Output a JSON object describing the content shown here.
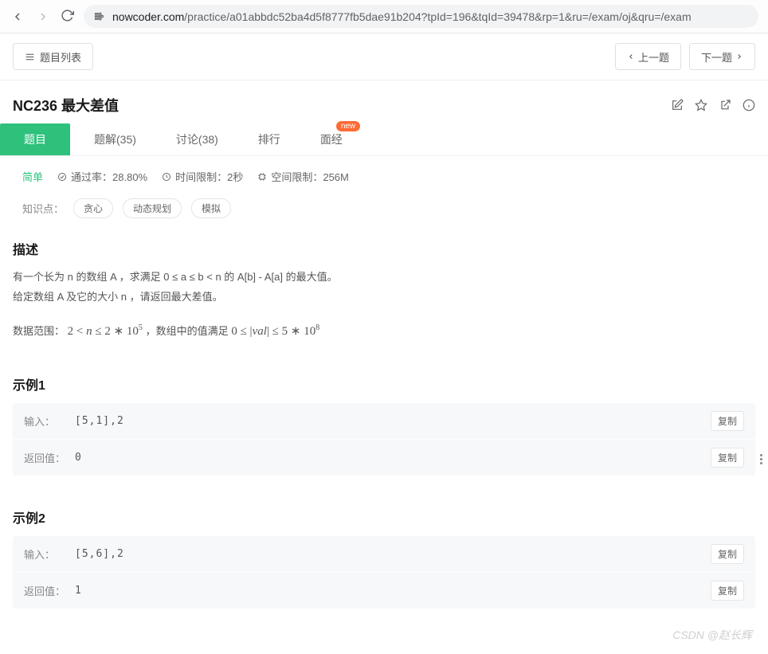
{
  "browser": {
    "url_domain": "nowcoder.com",
    "url_path": "/practice/a01abbdc52ba4d5f8777fb5dae91b204?tpId=196&tqId=39478&rp=1&ru=/exam/oj&qru=/exam"
  },
  "top": {
    "list_btn": "题目列表",
    "prev_btn": "上一题",
    "next_btn": "下一题"
  },
  "title": "NC236  最大差值",
  "tabs": {
    "problem": "题目",
    "solution": "题解(35)",
    "discuss": "讨论(38)",
    "rank": "排行",
    "interview": "面经",
    "new_badge": "new"
  },
  "meta": {
    "difficulty": "简单",
    "passrate": "通过率：28.80%",
    "timelimit": "时间限制：2秒",
    "memlimit": "空间限制：256M"
  },
  "tags": {
    "label": "知识点：",
    "items": [
      "贪心",
      "动态规划",
      "模拟"
    ]
  },
  "desc": {
    "heading": "描述",
    "line1": "有一个长为 n 的数组 A ，求满足 0 ≤ a ≤ b < n 的 A[b] - A[a] 的最大值。",
    "line2": "给定数组 A 及它的大小 n ，请返回最大差值。",
    "range_prefix": "数据范围：",
    "range_mid": "，数组中的值满足"
  },
  "ex1": {
    "heading": "示例1",
    "input_label": "输入：",
    "input_val": "[5,1],2",
    "output_label": "返回值：",
    "output_val": "0",
    "copy": "复制"
  },
  "ex2": {
    "heading": "示例2",
    "input_label": "输入：",
    "input_val": "[5,6],2",
    "output_label": "返回值：",
    "output_val": "1",
    "copy": "复制"
  },
  "watermark": "CSDN @赵长辉"
}
